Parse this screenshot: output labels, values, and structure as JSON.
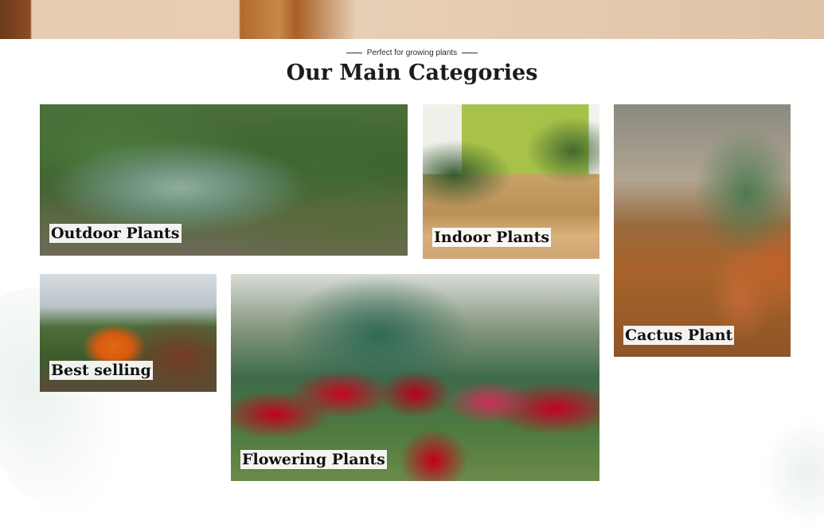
{
  "section": {
    "eyebrow": "Perfect for growing plants",
    "title": "Our Main Categories"
  },
  "categories": [
    {
      "label": "Outdoor Plants"
    },
    {
      "label": "Indoor Plants"
    },
    {
      "label": "Cactus Plant"
    },
    {
      "label": "Best selling"
    },
    {
      "label": "Flowering Plants"
    }
  ]
}
